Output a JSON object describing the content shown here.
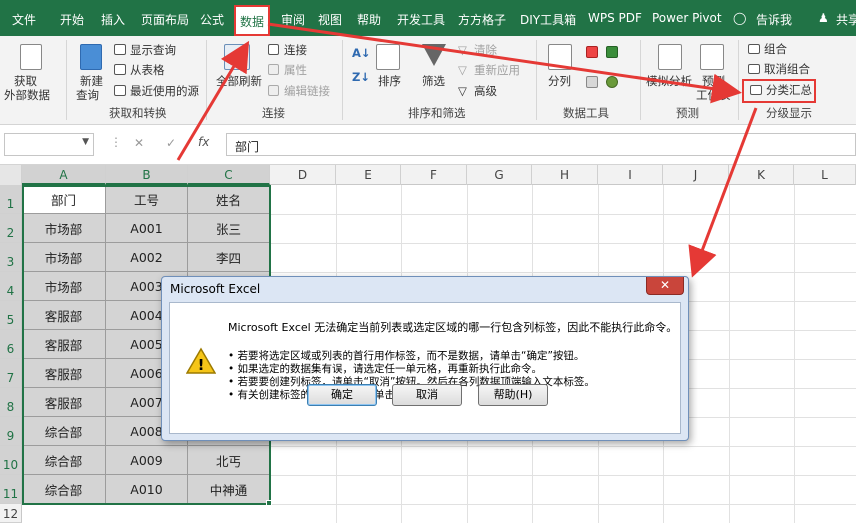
{
  "menu": {
    "tabs": [
      "文件",
      "开始",
      "插入",
      "页面布局",
      "公式",
      "数据",
      "审阅",
      "视图",
      "帮助",
      "开发工具",
      "方方格子",
      "DIY工具箱",
      "WPS PDF",
      "Power Pivot"
    ],
    "tell_me": "告诉我",
    "share": "共享"
  },
  "ribbon": {
    "get_external": [
      "获取",
      "外部数据"
    ],
    "new_query": [
      "新建",
      "查询"
    ],
    "show_query": "显示查询",
    "from_table": "从表格",
    "recent_sources": "最近使用的源",
    "group_get": "获取和转换",
    "refresh_all": [
      "全部刷新"
    ],
    "connections": "连接",
    "properties": "属性",
    "edit_links": "编辑链接",
    "group_conn": "连接",
    "sort": "排序",
    "filter": "筛选",
    "clear": "清除",
    "reapply": "重新应用",
    "advanced": "高级",
    "group_sort": "排序和筛选",
    "split": "分列",
    "group_tools": "数据工具",
    "what_if": "模拟分析",
    "forecast": "预测",
    "forecast_sheet": "工作表",
    "group_forecast": "预测",
    "group_btn": "组合",
    "ungroup": "取消组合",
    "subtotal": "分类汇总",
    "group_outline": "分级显示"
  },
  "formula_bar": {
    "cancel": "✕",
    "enter": "✓",
    "fx": "fx",
    "content": "部门"
  },
  "grid": {
    "columns": [
      "A",
      "B",
      "C",
      "D",
      "E",
      "F",
      "G",
      "H",
      "I",
      "J",
      "K",
      "L"
    ],
    "rows": [
      "1",
      "2",
      "3",
      "4",
      "5",
      "6",
      "7",
      "8",
      "9",
      "10",
      "11",
      "12"
    ],
    "headers": [
      "部门",
      "工号",
      "姓名"
    ],
    "data": [
      [
        "市场部",
        "A001",
        "张三"
      ],
      [
        "市场部",
        "A002",
        "李四"
      ],
      [
        "市场部",
        "A003",
        ""
      ],
      [
        "客服部",
        "A004",
        ""
      ],
      [
        "客服部",
        "A005",
        ""
      ],
      [
        "客服部",
        "A006",
        ""
      ],
      [
        "客服部",
        "A007",
        ""
      ],
      [
        "综合部",
        "A008",
        ""
      ],
      [
        "综合部",
        "A009",
        "北丐"
      ],
      [
        "综合部",
        "A010",
        "中神通"
      ]
    ]
  },
  "dialog": {
    "title": "Microsoft Excel",
    "message": "Microsoft Excel 无法确定当前列表或选定区域的哪一行包含列标签，因此不能执行此命令。",
    "bullets": [
      "• 若要将选定区域或列表的首行用作标签，而不是数据，请单击“确定”按钮。",
      "• 如果选定的数据集有误，请选定任一单元格，再重新执行此命令。",
      "• 若要要创建列标签，请单击“取消”按钮。然后在各列数据顶端输入文本标签。",
      "• 有关创建标签的详细内容，请单击“帮助”按钮。"
    ],
    "ok": "确定",
    "cancel": "取消",
    "help": "帮助(H)",
    "close": "✕",
    "warning": "!"
  },
  "colors": {
    "excel_green": "#217346",
    "annotation_red": "#e53935"
  }
}
